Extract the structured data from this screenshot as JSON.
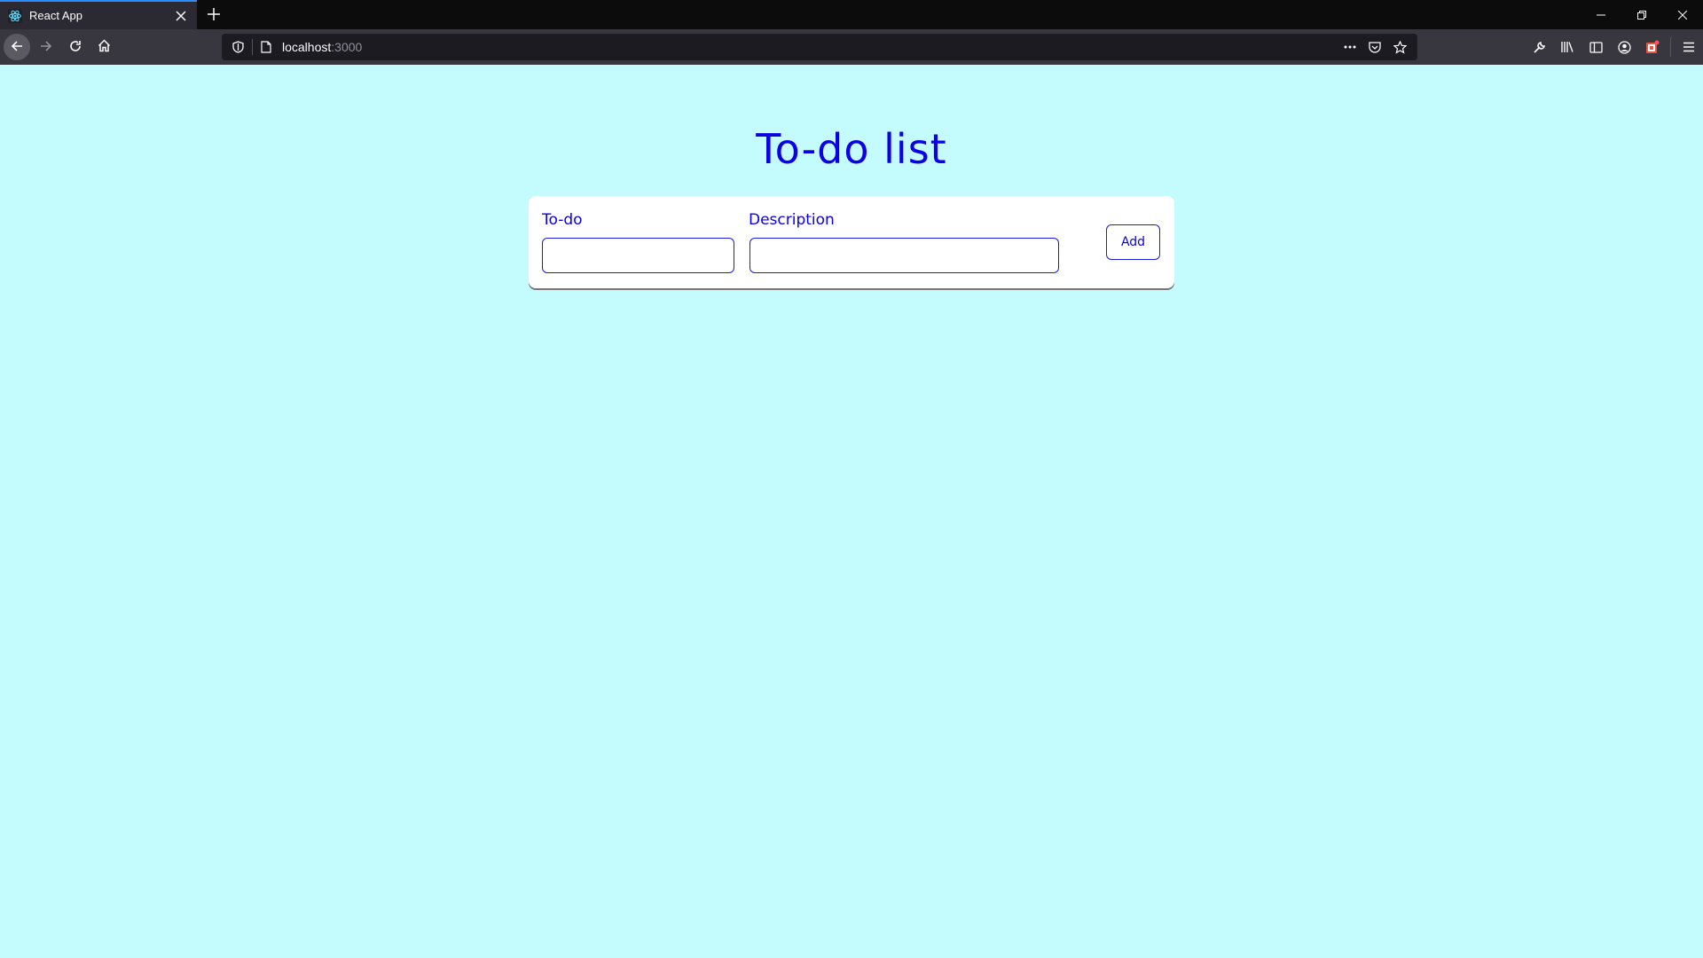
{
  "browser": {
    "tab": {
      "title": "React App",
      "favicon": "react-icon"
    },
    "new_tab_icon": "plus-icon",
    "window_controls": [
      "minimize-icon",
      "restore-icon",
      "close-icon"
    ],
    "nav": {
      "back_icon": "arrow-left-icon",
      "forward_icon": "arrow-right-icon",
      "reload_icon": "reload-icon",
      "home_icon": "home-icon"
    },
    "url": {
      "host": "localhost",
      "port": ":3000"
    },
    "url_actions": [
      "more-icon",
      "pocket-icon",
      "star-icon"
    ],
    "toolbar_icons": [
      "wrench-icon",
      "library-icon",
      "sidebar-icon",
      "account-icon",
      "extension-icon",
      "menu-icon"
    ],
    "colors": {
      "tabbar": "#0c0c0d",
      "navbar": "#38373f",
      "urlbar": "#1c1b22",
      "active_tab_accent": "#2a8cff"
    }
  },
  "app": {
    "title": "To-do list",
    "form": {
      "todo_label": "To-do",
      "todo_value": "",
      "description_label": "Description",
      "description_value": "",
      "add_button": "Add"
    },
    "colors": {
      "background": "#c4fbfd",
      "accent": "#0b00e6",
      "card": "#ffffff"
    }
  }
}
